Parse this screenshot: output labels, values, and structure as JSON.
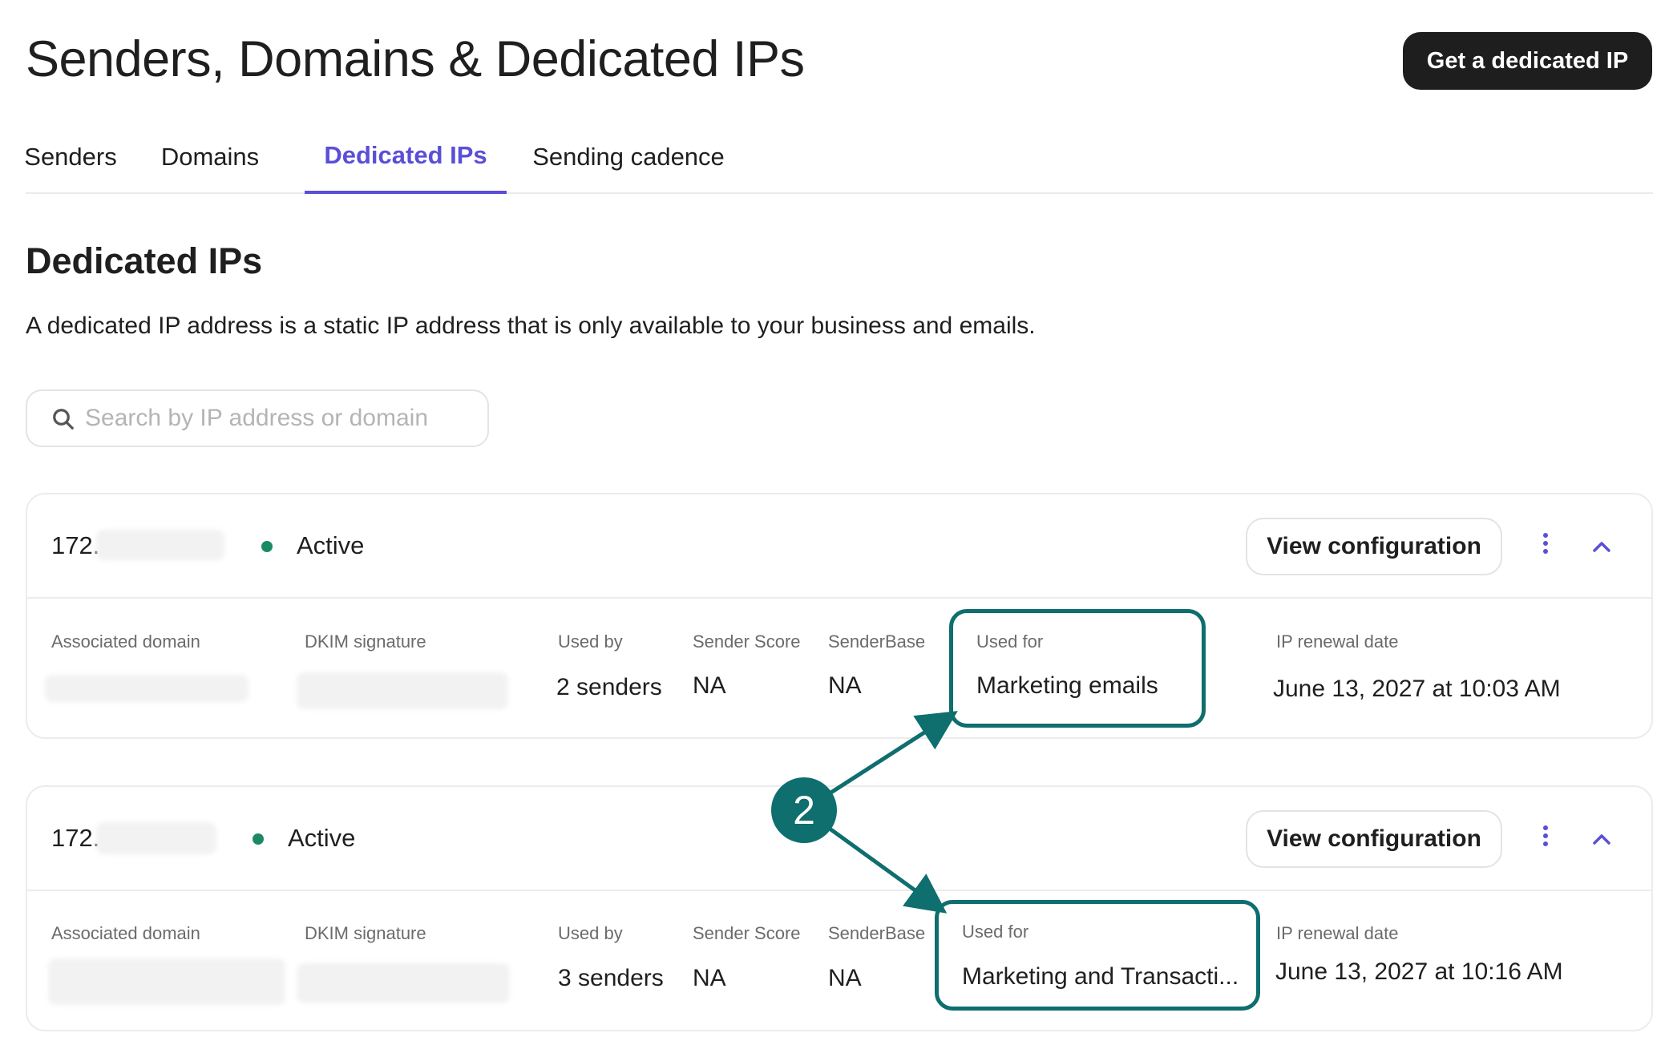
{
  "header": {
    "title": "Senders, Domains & Dedicated IPs",
    "primary_button": "Get a dedicated IP"
  },
  "tabs": [
    {
      "label": "Senders",
      "active": false
    },
    {
      "label": "Domains",
      "active": false
    },
    {
      "label": "Dedicated IPs",
      "active": true
    },
    {
      "label": "Sending cadence",
      "active": false
    }
  ],
  "section": {
    "title": "Dedicated IPs",
    "description": "A dedicated IP address is a static IP address that is only available to your business and emails."
  },
  "search": {
    "placeholder": "Search by IP address or domain",
    "value": ""
  },
  "labels": {
    "associated_domain": "Associated domain",
    "dkim_signature": "DKIM signature",
    "used_by": "Used by",
    "sender_score": "Sender Score",
    "senderbase": "SenderBase",
    "used_for": "Used for",
    "ip_renewal_date": "IP renewal date",
    "view_configuration": "View configuration"
  },
  "ips": [
    {
      "ip_prefix": "172.",
      "status": "Active",
      "used_by": "2 senders",
      "sender_score": "NA",
      "senderbase": "NA",
      "used_for": "Marketing emails",
      "renewal_date": "June 13, 2027 at 10:03 AM"
    },
    {
      "ip_prefix": "172.",
      "status": "Active",
      "used_by": "3 senders",
      "sender_score": "NA",
      "senderbase": "NA",
      "used_for": "Marketing and Transacti...",
      "renewal_date": "June 13, 2027 at 10:16 AM"
    }
  ],
  "annotation": {
    "callout_number": "2"
  },
  "colors": {
    "accent": "#5a4fd6",
    "status_active": "#1b8a64",
    "annotation": "#0f6e6e",
    "primary_button_bg": "#1e1e1e"
  },
  "icons": [
    "search-icon",
    "kebab-menu-icon",
    "chevron-up-icon",
    "status-dot-icon",
    "arrow-icon"
  ]
}
